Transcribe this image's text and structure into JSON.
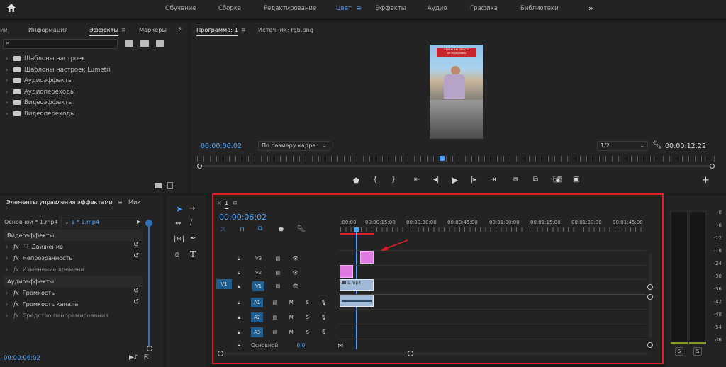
{
  "workspaces": [
    "Обучение",
    "Сборка",
    "Редактирование",
    "Цвет",
    "Эффекты",
    "Аудио",
    "Графика",
    "Библиотеки"
  ],
  "active_workspace_index": 3,
  "workspace_menu_glyph": "≡",
  "more_glyph": "»",
  "colors": {
    "accent": "#4aa3ff",
    "highlight_red": "#e01f26",
    "clip_pink": "#e07ae3",
    "track_blue": "#1f5d8e"
  },
  "effects_panel": {
    "tabs": [
      "Информация",
      "Эффекты",
      "Маркеры"
    ],
    "active_tab": "Эффекты",
    "partial_left_tab": "ии",
    "search_placeholder": "",
    "items": [
      "Шаблоны настроек",
      "Шаблоны настроек Lumetri",
      "Аудиоэффекты",
      "Аудиопереходы",
      "Видеоэффекты",
      "Видеопереходы"
    ]
  },
  "program_monitor": {
    "tab": "Программа: 1",
    "source_tab": "Источник: rgb.png",
    "timecode": "00:00:06:02",
    "fit": "По размеру кадра",
    "resolution": "1/2",
    "duration": "00:00:12:22",
    "overlay_text": "ЧТОБЫ ВЫ ПРОСТО\nне смущались"
  },
  "effect_controls": {
    "tab": "Элементы управления эффектами",
    "tab2": "Мик",
    "source": "Основной * 1.mp4",
    "clip": "1 * 1.mp4",
    "video_header": "Видеоэффекты",
    "video_items": [
      "Движение",
      "Непрозрачность",
      "Изменение времени"
    ],
    "audio_header": "Аудиоэффекты",
    "audio_items": [
      "Громкость",
      "Громкость канала",
      "Средство панорамирования"
    ],
    "timecode": "00:00:06:02"
  },
  "timeline": {
    "tab": "1",
    "timecode": "00:00:06:02",
    "ruler": [
      ":00:00",
      "00:00:15:00",
      "00:00:30:00",
      "00:00:45:00",
      "00:01:00:00",
      "00:01:15:00",
      "00:01:30:00",
      "00:01:45:00"
    ],
    "video_tracks": [
      "V3",
      "V2",
      "V1"
    ],
    "audio_tracks": [
      "A1",
      "A2",
      "A3"
    ],
    "source_patch": "V1",
    "master": "Основной",
    "master_value": "0,0",
    "clip_label": "1.mp4",
    "mute": "M",
    "solo": "S"
  },
  "meter": {
    "ticks": [
      "0",
      "-6",
      "-12",
      "-18",
      "-24",
      "-30",
      "-36",
      "-42",
      "-48",
      "-54",
      "dB"
    ],
    "solo_buttons": [
      "S",
      "S"
    ]
  }
}
